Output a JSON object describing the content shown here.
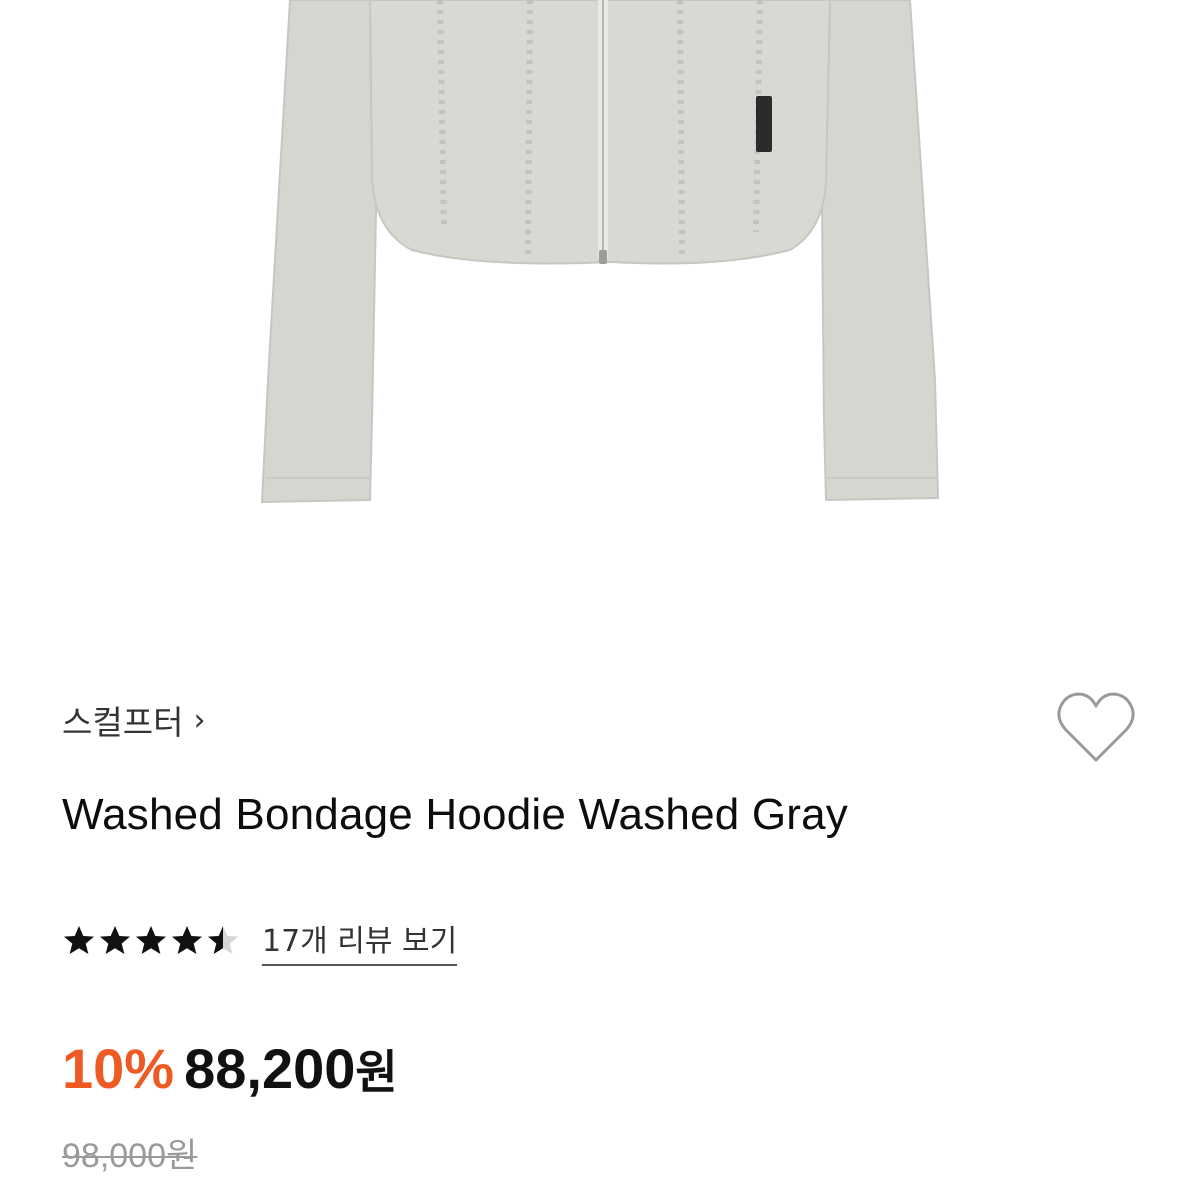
{
  "brand": {
    "name": "스컬프터",
    "chevron": "›",
    "chevron_icon": "chevron-right-icon"
  },
  "wishlist": {
    "icon": "heart-outline-icon",
    "active": false
  },
  "product": {
    "title": "Washed Bondage Hoodie Washed Gray"
  },
  "rating": {
    "stars": 4.5,
    "max": 5,
    "review_link": "17개 리뷰 보기"
  },
  "price": {
    "discount": "10%",
    "sale": "88,200",
    "currency": "원",
    "original": "98,000원",
    "discount_color": "#ee5a24"
  }
}
